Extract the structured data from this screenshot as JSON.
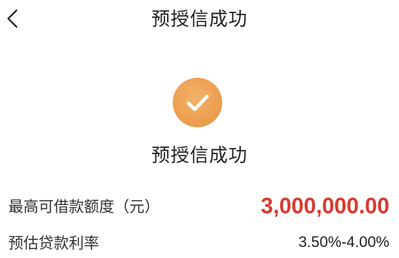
{
  "header": {
    "title": "预授信成功",
    "back_icon": "chevron-left-icon"
  },
  "status": {
    "icon": "check-circle-icon",
    "icon_color": "#eda052",
    "text": "预授信成功"
  },
  "details": {
    "max_limit_label": "最高可借款额度（元）",
    "max_limit_value": "3,000,000.00",
    "max_limit_color": "#d83a30",
    "rate_label": "预估贷款利率",
    "rate_value": "3.50%-4.00%"
  }
}
